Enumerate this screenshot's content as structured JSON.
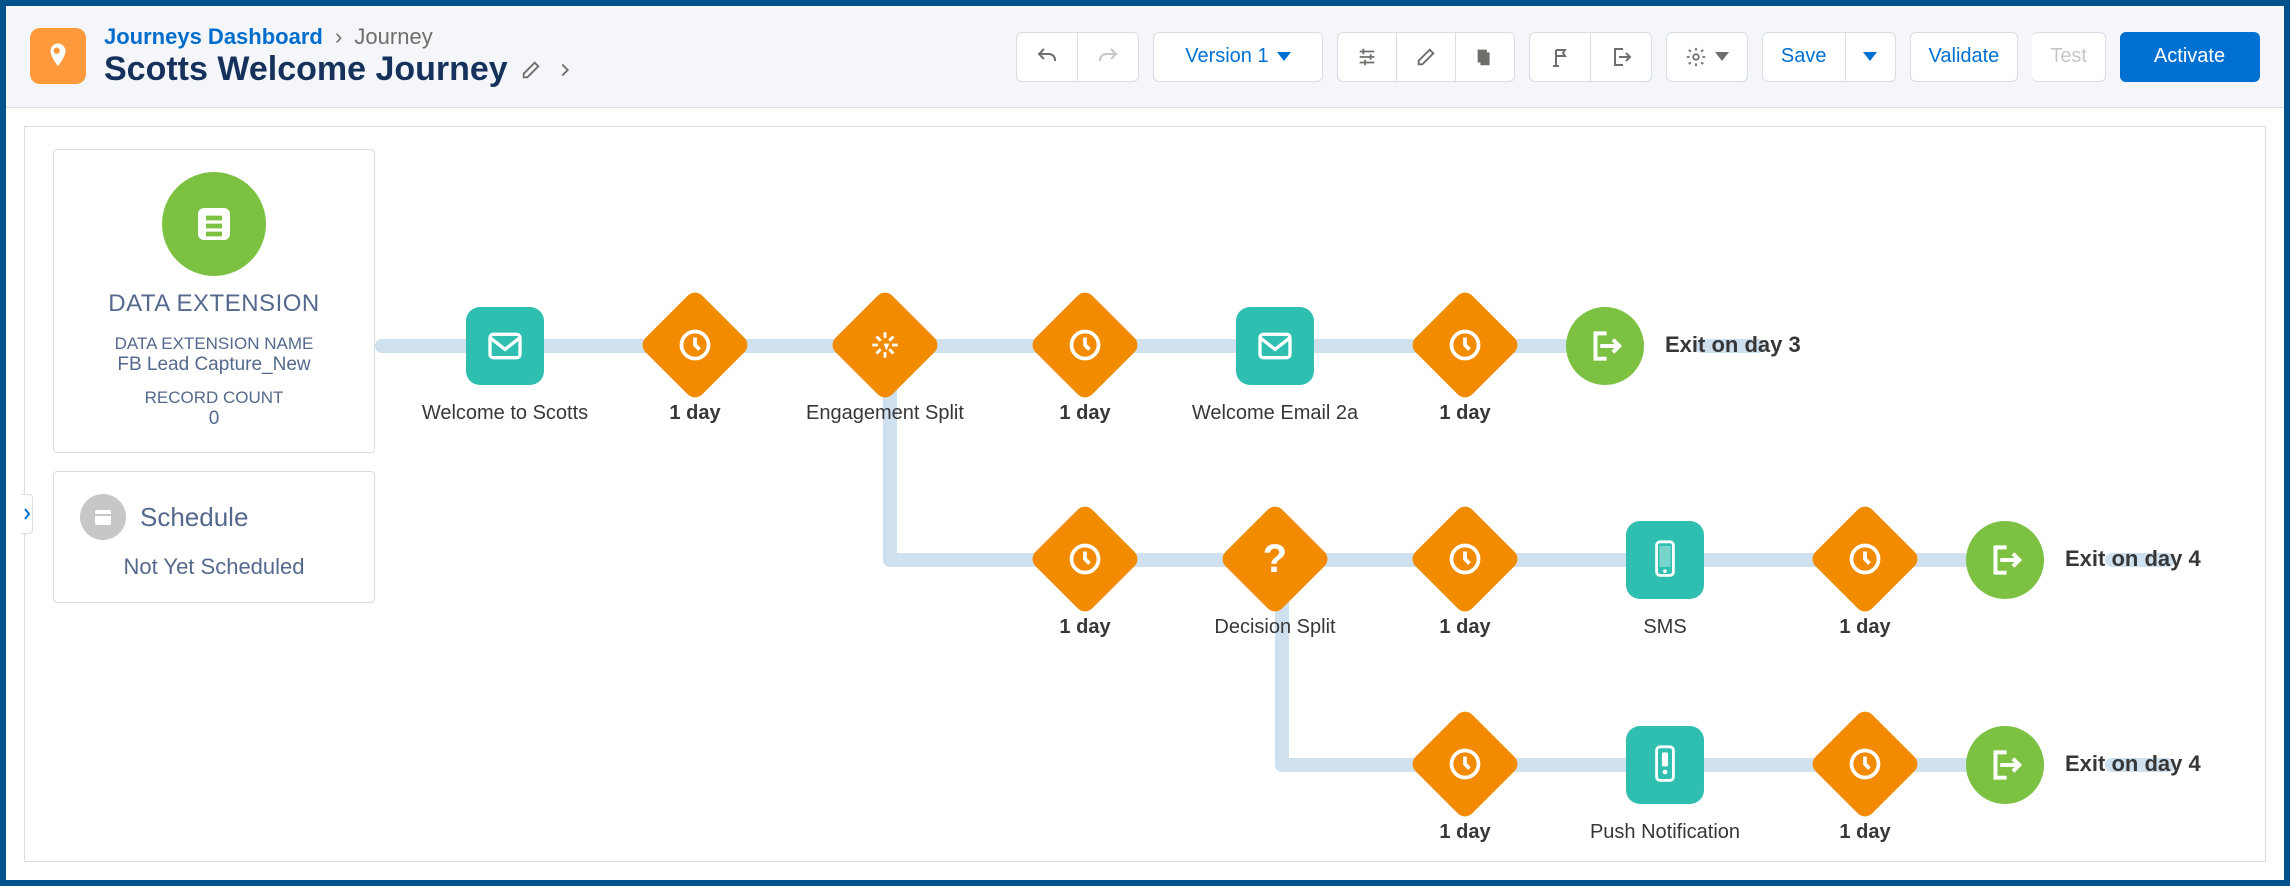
{
  "header": {
    "breadcrumb_root": "Journeys Dashboard",
    "breadcrumb_leaf": "Journey",
    "title": "Scotts Welcome Journey"
  },
  "toolbar": {
    "version_label": "Version 1",
    "save_label": "Save",
    "validate_label": "Validate",
    "test_label": "Test",
    "activate_label": "Activate"
  },
  "entry_source": {
    "heading": "DATA EXTENSION",
    "name_label": "DATA EXTENSION NAME",
    "name_value": "FB Lead Capture_New",
    "count_label": "RECORD COUNT",
    "count_value": "0"
  },
  "schedule": {
    "heading": "Schedule",
    "status": "Not Yet Scheduled"
  },
  "nodes": {
    "email1": "Welcome to Scotts",
    "wait1": "1 day",
    "engage": "Engagement Split",
    "wait2": "1 day",
    "email2": "Welcome Email 2a",
    "wait3": "1 day",
    "exit1": "Exit on day 3",
    "wait4": "1 day",
    "decision": "Decision Split",
    "wait5": "1 day",
    "sms": "SMS",
    "wait6": "1 day",
    "exit2": "Exit on day 4",
    "wait7": "1 day",
    "push": "Push Notification",
    "wait8": "1 day",
    "exit3": "Exit on day 4"
  },
  "colors": {
    "brand_blue": "#0070d2",
    "teal": "#2ebfb1",
    "orange": "#f28b00",
    "green": "#7cc142"
  }
}
